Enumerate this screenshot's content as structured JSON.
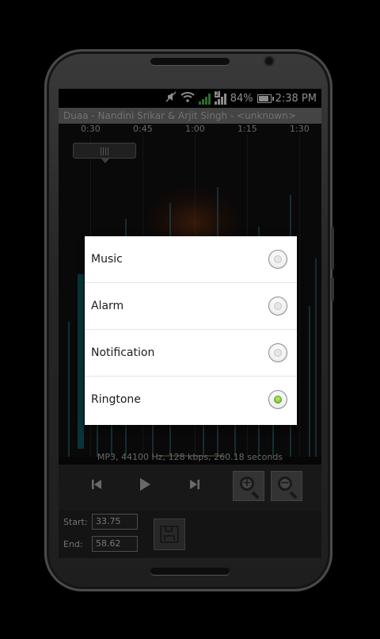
{
  "status_bar": {
    "battery": "84%",
    "time": "2:38 PM",
    "sim_badge": "2",
    "icons": [
      "mute-icon",
      "wifi-icon",
      "signal-icon",
      "signal-2-icon",
      "battery-icon"
    ]
  },
  "track_title": "Duaa - Nandini Srikar & Arjit Singh - <unknown>",
  "timeline_ticks": [
    "0:30",
    "0:45",
    "1:00",
    "1:15",
    "1:30"
  ],
  "file_info": "MP3, 44100 Hz, 128 kbps, 260.18 seconds",
  "controls": {
    "prev_icon": "skip-previous-icon",
    "play_icon": "play-icon",
    "next_icon": "skip-next-icon",
    "zoom_in_icon": "zoom-in-icon",
    "zoom_out_icon": "zoom-out-icon"
  },
  "edit_panel": {
    "start_label": "Start:",
    "start_value": "33.75",
    "end_label": "End:",
    "end_value": "58.62",
    "save_icon": "save-disk-icon"
  },
  "dialog": {
    "options": [
      {
        "label": "Music",
        "selected": false
      },
      {
        "label": "Alarm",
        "selected": false
      },
      {
        "label": "Notification",
        "selected": false
      },
      {
        "label": "Ringtone",
        "selected": true
      }
    ]
  },
  "colors": {
    "radio_selected": "#7dc82f",
    "dialog_bg": "#ffffff",
    "screen_bg": "#0c0c0c"
  }
}
